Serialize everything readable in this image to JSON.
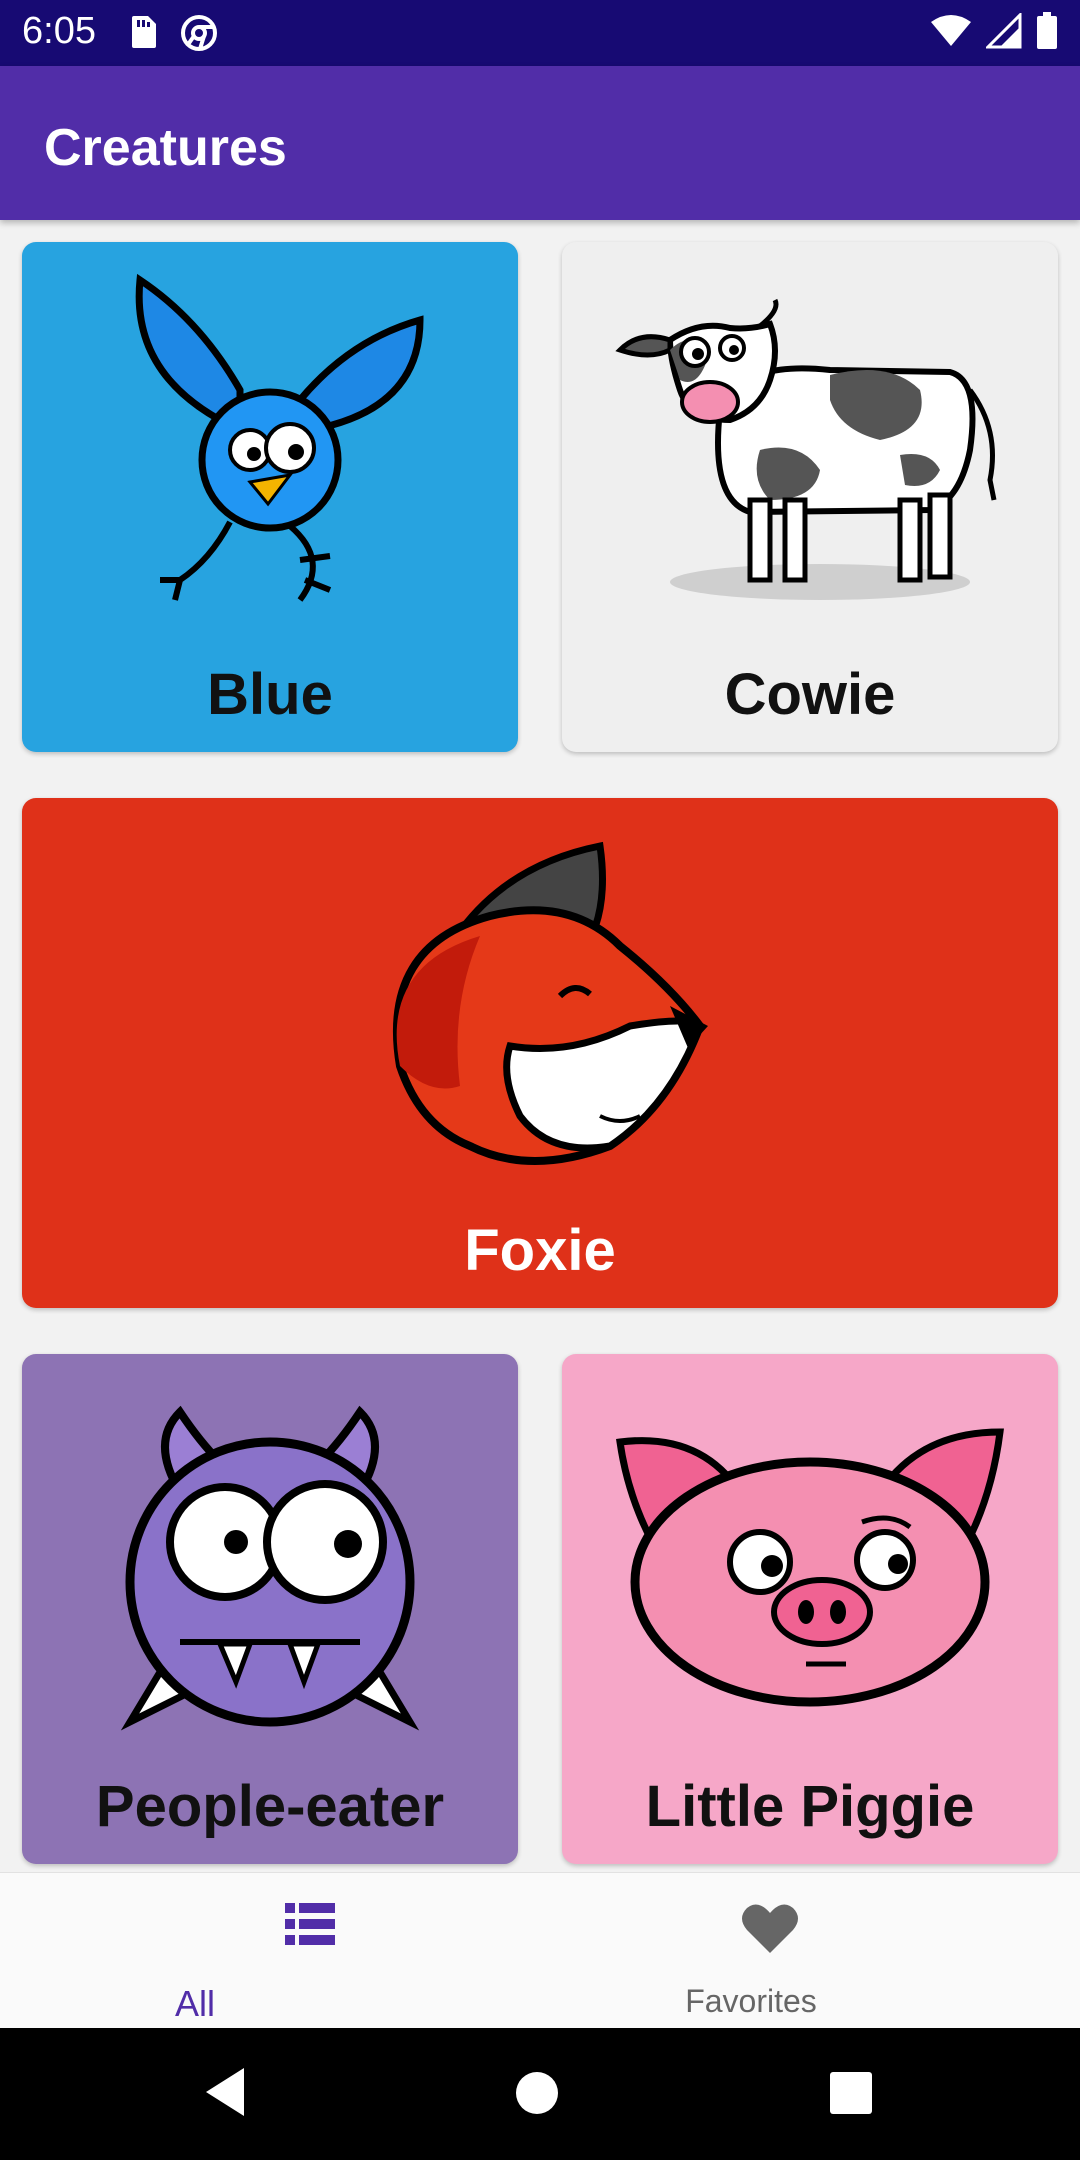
{
  "status": {
    "time": "6:05",
    "left_icons": [
      "sd-card-icon",
      "chrome-icon"
    ],
    "right_icons": [
      "wifi-icon",
      "signal-icon",
      "battery-icon"
    ]
  },
  "appbar": {
    "title": "Creatures"
  },
  "creatures": [
    {
      "name": "Blue",
      "bg": "#27a3e0",
      "icon": "blue-bird-icon"
    },
    {
      "name": "Cowie",
      "bg": "#efefef",
      "icon": "cow-icon"
    },
    {
      "name": "Foxie",
      "bg": "#df3119",
      "icon": "fox-icon"
    },
    {
      "name": "People-eater",
      "bg": "#8d73b4",
      "icon": "monster-icon"
    },
    {
      "name": "Little Piggie",
      "bg": "#f6a7c8",
      "icon": "pig-icon"
    }
  ],
  "bottom_nav": {
    "items": [
      {
        "label": "All",
        "icon": "list-icon",
        "active": true
      },
      {
        "label": "Favorites",
        "icon": "heart-icon",
        "active": false
      }
    ],
    "active_color": "#512da8",
    "inactive_color": "#666666"
  },
  "system_nav": [
    "back-button",
    "home-button",
    "recents-button"
  ],
  "colors": {
    "status_bar": "#170a73",
    "app_bar": "#512da8",
    "page_background": "#f2f2f2"
  }
}
